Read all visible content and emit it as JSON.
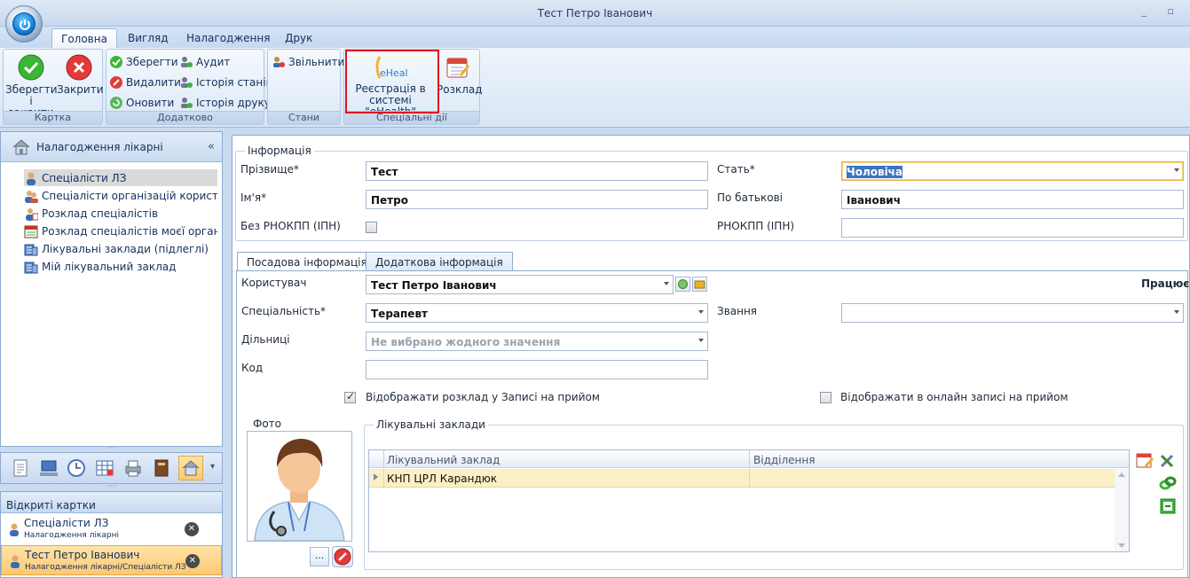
{
  "window": {
    "title": "Тест Петро Іванович",
    "controls": "_ ▫"
  },
  "tabs": [
    "Головна",
    "Вигляд",
    "Налагодження",
    "Друк"
  ],
  "ribbon": {
    "card_group": {
      "label": "Картка",
      "save_close": "Зберегти і закрити",
      "save_close_l1": "Зберегти",
      "save_close_l2": "і закрити",
      "close": "Закрити"
    },
    "extra_group": {
      "label": "Додатково",
      "save": "Зберегти",
      "delete": "Видалити",
      "refresh": "Оновити",
      "audit": "Аудит",
      "state_history": "Історія станів",
      "print_history": "Історія друку"
    },
    "states_group": {
      "label": "Стани",
      "dismiss": "Звільнити"
    },
    "special_group": {
      "label": "Спеціальні дії",
      "ehealth_l1": "Реєстрація в",
      "ehealth_l2": "системі \"eHealth\"",
      "ehealth_logo": "eHealth",
      "schedule": "Розклад"
    }
  },
  "left_panel": {
    "header": "Налагодження лікарні",
    "collapse": "«",
    "items": [
      "Спеціалісти ЛЗ",
      "Спеціалісти організацій користувач",
      "Розклад спеціалістів",
      "Розклад спеціалістів моєї організац",
      "Лікувальні заклади (підлеглі)",
      "Мій лікувальний заклад"
    ],
    "strip_more": "▾"
  },
  "open_cards": {
    "header": "Відкриті картки",
    "items": [
      {
        "title": "Спеціалісти ЛЗ",
        "path": "Налагодження лікарні"
      },
      {
        "title": "Тест Петро Іванович",
        "path": "Налагодження лікарні/Спеціалісти ЛЗ"
      }
    ]
  },
  "info": {
    "legend": "Інформація",
    "surname_label": "Прізвище*",
    "surname": "Тест",
    "name_label": "Ім'я*",
    "name": "Петро",
    "no_rnokpp_label": "Без РНОКПП (ІПН)",
    "gender_label": "Стать*",
    "gender": "Чоловіча",
    "patronymic_label": "По батькові",
    "patronymic": "Іванович",
    "rnokpp_label": "РНОКПП (ІПН)",
    "rnokpp": ""
  },
  "subtabs": [
    "Посадова інформація",
    "Додаткова інформація"
  ],
  "position": {
    "user_label": "Користувач",
    "user": "Тест Петро Іванович",
    "status": "Працює",
    "specialty_label": "Спеціальність*",
    "specialty": "Терапевт",
    "rank_label": "Звання",
    "rank": "",
    "districts_label": "Дільниці",
    "districts_placeholder": "Не вибрано жодного значення",
    "code_label": "Код",
    "code": "",
    "show_schedule": "Відображати розклад у Записі на прийом",
    "show_online": "Відображати в онлайн записі на прийом",
    "show_schedule_checked": true,
    "show_online_checked": false
  },
  "photo": {
    "legend": "Фото",
    "browse": "..."
  },
  "facilities": {
    "legend": "Лікувальні заклади",
    "columns": [
      "Лікувальний заклад",
      "Відділення"
    ],
    "rows": [
      {
        "facility": "КНП ЦРЛ Карандюк",
        "department": ""
      }
    ]
  },
  "colors": {
    "accent": "#e0141e",
    "selected_row": "#fbefc6",
    "active_card": "#fbc873"
  }
}
